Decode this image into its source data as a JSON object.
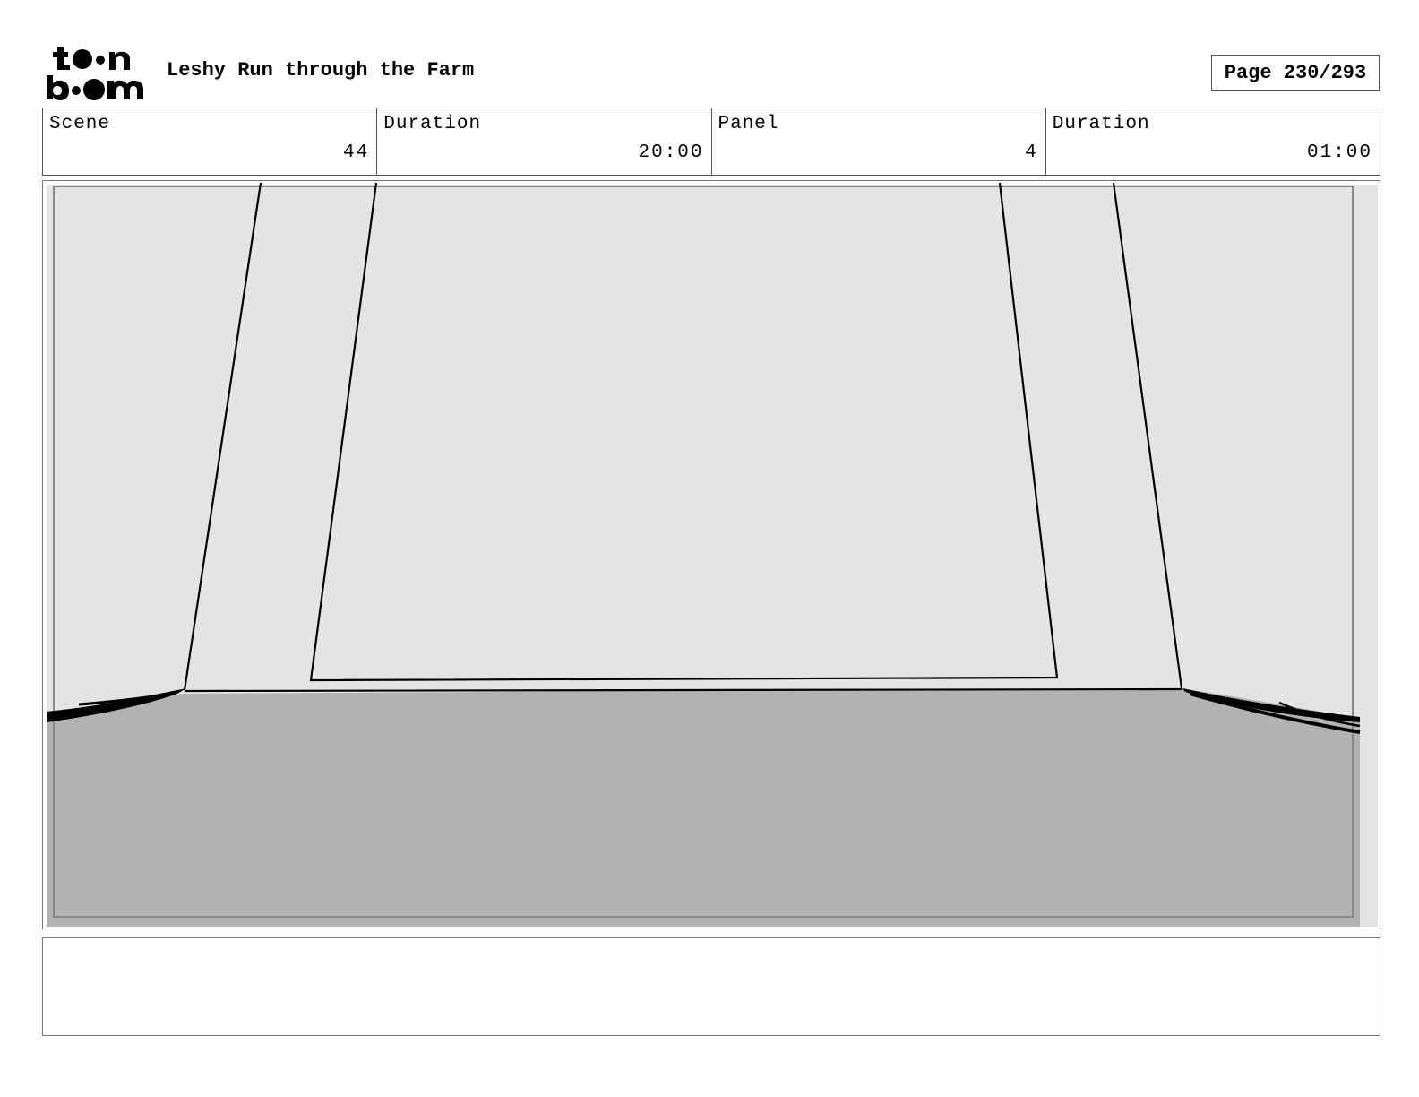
{
  "header": {
    "logo_text": "toon boom",
    "title": "Leshy Run through the Farm",
    "page": "Page 230/293"
  },
  "info": {
    "scene_label": "Scene",
    "scene_value": "44",
    "scene_duration_label": "Duration",
    "scene_duration_value": "20:00",
    "panel_label": "Panel",
    "panel_value": "4",
    "panel_duration_label": "Duration",
    "panel_duration_value": "01:00"
  },
  "panel_drawing": {
    "description_icon": "storyboard-sketch",
    "colors": {
      "wall": "#e4e4e4",
      "floor": "#b2b2b2",
      "ink": "#000000"
    }
  },
  "notes": {
    "text": ""
  }
}
